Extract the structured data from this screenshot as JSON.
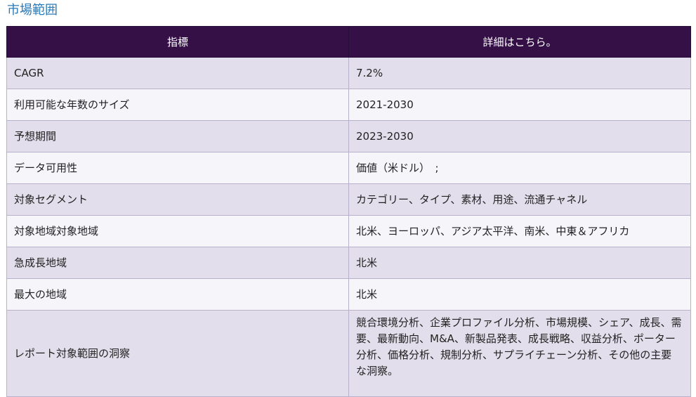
{
  "section": {
    "title": "市場範囲"
  },
  "table": {
    "headers": [
      "指標",
      "詳細はこちら。"
    ],
    "rows": [
      {
        "label": "CAGR",
        "value": "7.2%"
      },
      {
        "label": "利用可能な年数のサイズ",
        "value": "2021-2030"
      },
      {
        "label": "予想期間",
        "value": "2023-2030"
      },
      {
        "label": "データ可用性",
        "value": "価値（米ドル）　;"
      },
      {
        "label": "対象セグメント",
        "value": "カテゴリー、タイプ、素材、用途、流通チャネル"
      },
      {
        "label": "対象地域対象地域",
        "value": "北米、ヨーロッパ、アジア太平洋、南米、中東＆アフリカ"
      },
      {
        "label": "急成長地域",
        "value": "北米"
      },
      {
        "label": "最大の地域",
        "value": "北米"
      },
      {
        "label": "レポート対象範囲の洞察",
        "value": "競合環境分析、企業プロファイル分析、市場規模、シェア、成長、需要、最新動向、M&A、新製品発表、成長戦略、収益分析、ポーター分析、価格分析、規制分析、サプライチェーン分析、その他の主要な洞察。"
      }
    ]
  },
  "colors": {
    "header_bg": "#341047",
    "row_odd": "#e2deeb",
    "row_even": "#f6f5fa",
    "heading_text": "#2a7ab8"
  },
  "chart_data": {
    "type": "table",
    "columns": [
      "指標",
      "詳細はこちら。"
    ],
    "rows": [
      [
        "CAGR",
        "7.2%"
      ],
      [
        "利用可能な年数のサイズ",
        "2021-2030"
      ],
      [
        "予想期間",
        "2023-2030"
      ],
      [
        "データ可用性",
        "価値（米ドル）　;"
      ],
      [
        "対象セグメント",
        "カテゴリー、タイプ、素材、用途、流通チャネル"
      ],
      [
        "対象地域対象地域",
        "北米、ヨーロッパ、アジア太平洋、南米、中東＆アフリカ"
      ],
      [
        "急成長地域",
        "北米"
      ],
      [
        "最大の地域",
        "北米"
      ],
      [
        "レポート対象範囲の洞察",
        "競合環境分析、企業プロファイル分析、市場規模、シェア、成長、需要、最新動向、M&A、新製品発表、成長戦略、収益分析、ポーター分析、価格分析、規制分析、サプライチェーン分析、その他の主要な洞察。"
      ]
    ]
  }
}
